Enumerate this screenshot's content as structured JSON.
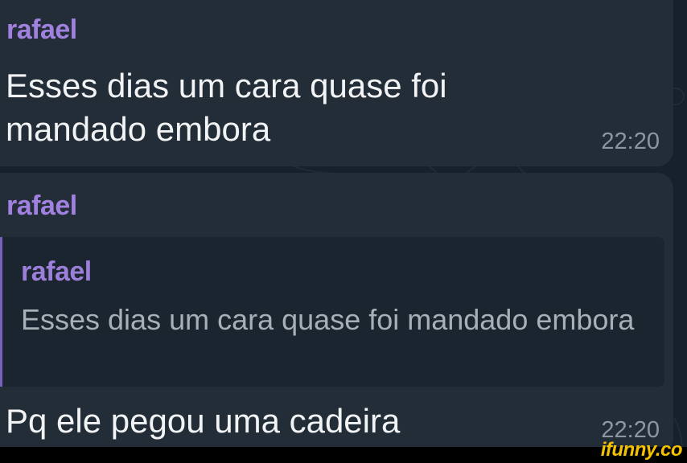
{
  "messages": [
    {
      "sender": "rafael",
      "text": "Esses dias um cara quase foi mandado embora",
      "time": "22:20"
    },
    {
      "sender": "rafael",
      "reply_to": {
        "sender": "rafael",
        "text": "Esses dias um cara quase foi mandado embora"
      },
      "text": "Pq ele pegou uma cadeira",
      "time": "22:20"
    }
  ],
  "watermark": {
    "text": "ifunny.co"
  },
  "colors": {
    "background": "#16212b",
    "bubble": "#222d37",
    "reply_box": "#1b252f",
    "sender_name": "#a181e0",
    "message_text": "#f1f3f5",
    "timestamp": "#8c97a2",
    "watermark": "#f5c200"
  }
}
